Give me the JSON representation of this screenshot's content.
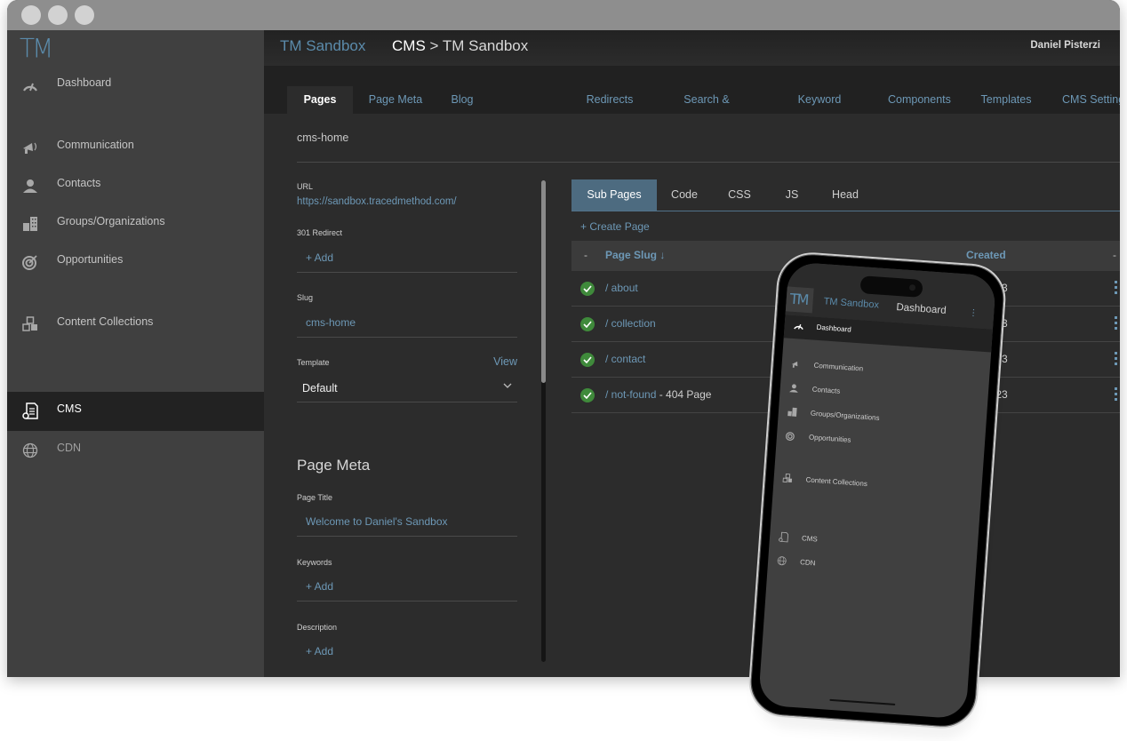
{
  "app": {
    "logo_text": "TM",
    "title": "TM Sandbox",
    "breadcrumb_section": "CMS",
    "breadcrumb_separator": " > ",
    "breadcrumb_page": "TM Sandbox",
    "user_name": "Daniel Pisterzi",
    "accent_color": "#5b8bab"
  },
  "sidebar": {
    "items": [
      {
        "label": "Dashboard",
        "icon": "speedometer-icon"
      },
      {
        "label": "Communication",
        "icon": "megaphone-icon"
      },
      {
        "label": "Contacts",
        "icon": "person-icon"
      },
      {
        "label": "Groups/Organizations",
        "icon": "buildings-icon"
      },
      {
        "label": "Opportunities",
        "icon": "target-icon"
      },
      {
        "label": "Content Collections",
        "icon": "boxes-icon"
      },
      {
        "label": "CMS",
        "icon": "document-gear-icon",
        "active": true
      },
      {
        "label": "CDN",
        "icon": "globe-icon"
      }
    ]
  },
  "tabs": [
    {
      "label": "Pages",
      "active": true
    },
    {
      "label": "Page Meta"
    },
    {
      "label": "Blog"
    },
    {
      "label": "Redirects"
    },
    {
      "label": "Search & Replace"
    },
    {
      "label": "Keyword Search"
    },
    {
      "label": "Components"
    },
    {
      "label": "Templates"
    },
    {
      "label": "CMS Settings"
    }
  ],
  "page": {
    "slug_heading": "cms-home",
    "url_label": "URL",
    "url_value": "https://sandbox.tracedmethod.com/",
    "redirect_label": "301 Redirect",
    "redirect_add": "+ Add",
    "slug_label": "Slug",
    "slug_value": "cms-home",
    "template_label": "Template",
    "template_view": "View",
    "template_value": "Default",
    "meta_section_title": "Page Meta",
    "page_title_label": "Page Title",
    "page_title_value": "Welcome to Daniel's Sandbox",
    "keywords_label": "Keywords",
    "keywords_add": "+ Add",
    "description_label": "Description",
    "description_add": "+ Add"
  },
  "subtabs": [
    {
      "label": "Sub Pages",
      "active": true
    },
    {
      "label": "Code"
    },
    {
      "label": "CSS"
    },
    {
      "label": "JS"
    },
    {
      "label": "Head"
    }
  ],
  "subpages": {
    "create_label": "+ Create Page",
    "header_toggle": "-",
    "col_slug": "Page Slug",
    "sort_icon": "↓",
    "col_created": "Created",
    "header_toggle_right": "-",
    "rows": [
      {
        "slug": "/ about",
        "suffix": "",
        "created": "19, 2023",
        "status": "published"
      },
      {
        "slug": "/ collection",
        "suffix": "",
        "created": "19, 2023",
        "status": "published"
      },
      {
        "slug": "/ contact",
        "suffix": "",
        "created": "16, 2023",
        "status": "published"
      },
      {
        "slug": "/ not-found",
        "suffix": " - 404 Page",
        "created": "19, 2023",
        "status": "published"
      }
    ]
  },
  "phone": {
    "logo_text": "TM",
    "title": "TM Sandbox",
    "page": "Dashboard",
    "menu_dots": "⋮",
    "items": [
      {
        "label": "Dashboard"
      },
      {
        "label": "Communication"
      },
      {
        "label": "Contacts"
      },
      {
        "label": "Groups/Organizations"
      },
      {
        "label": "Opportunities"
      },
      {
        "label": "Content Collections"
      },
      {
        "label": "CMS"
      },
      {
        "label": "CDN"
      }
    ]
  }
}
